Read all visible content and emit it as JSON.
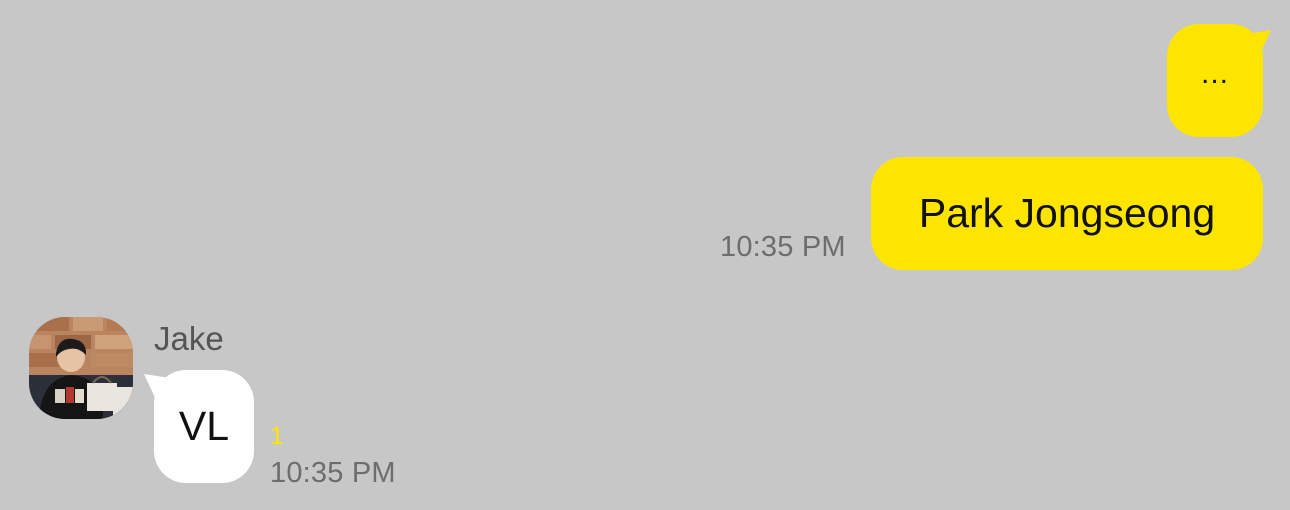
{
  "theme": {
    "background": "#c7c7c7",
    "sent_bubble_color": "#fee500",
    "received_bubble_color": "#ffffff",
    "timestamp_color": "#6d6d6d",
    "unread_color": "#fee500"
  },
  "messages_sent": [
    {
      "text": "..."
    },
    {
      "text": "Park Jongseong",
      "time": "10:35 PM"
    }
  ],
  "message_received": {
    "sender": "Jake",
    "avatar_icon": "profile-photo",
    "text": "VL",
    "unread": "1",
    "time": "10:35 PM"
  }
}
